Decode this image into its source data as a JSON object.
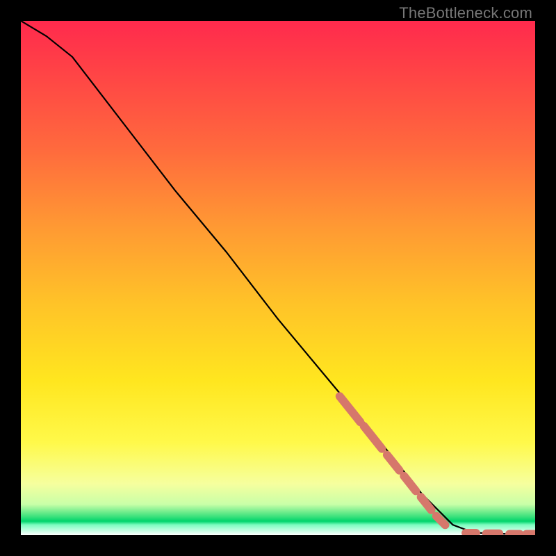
{
  "watermark": "TheBottleneck.com",
  "chart_data": {
    "type": "line",
    "title": "",
    "xlabel": "",
    "ylabel": "",
    "xlim": [
      0,
      100
    ],
    "ylim": [
      0,
      100
    ],
    "grid": false,
    "legend": false,
    "series": [
      {
        "name": "curve",
        "x": [
          0,
          5,
          10,
          20,
          30,
          40,
          50,
          60,
          70,
          78,
          84,
          88,
          92,
          96,
          100
        ],
        "y": [
          100,
          97,
          93,
          80,
          67,
          55,
          42,
          30,
          18,
          8,
          2,
          0.5,
          0.3,
          0.2,
          0.2
        ]
      }
    ],
    "highlight_dashes": {
      "diagonal": [
        {
          "x0": 62,
          "y0": 27,
          "x1": 66,
          "y1": 22
        },
        {
          "x0": 66.7,
          "y0": 21.2,
          "x1": 70.2,
          "y1": 16.8
        },
        {
          "x0": 71.2,
          "y0": 15.6,
          "x1": 73.6,
          "y1": 12.6
        },
        {
          "x0": 74.5,
          "y0": 11.5,
          "x1": 76.8,
          "y1": 8.6
        },
        {
          "x0": 77.8,
          "y0": 7.4,
          "x1": 79.8,
          "y1": 4.9
        },
        {
          "x0": 80.8,
          "y0": 3.7,
          "x1": 82.5,
          "y1": 2.0
        }
      ],
      "horizontal": [
        {
          "x0": 86.5,
          "y0": 0.4,
          "x1": 88.5,
          "y1": 0.4
        },
        {
          "x0": 90.5,
          "y0": 0.3,
          "x1": 93.0,
          "y1": 0.3
        },
        {
          "x0": 95.0,
          "y0": 0.2,
          "x1": 97.0,
          "y1": 0.2
        },
        {
          "x0": 98.3,
          "y0": 0.2,
          "x1": 99.8,
          "y1": 0.2
        }
      ]
    }
  }
}
